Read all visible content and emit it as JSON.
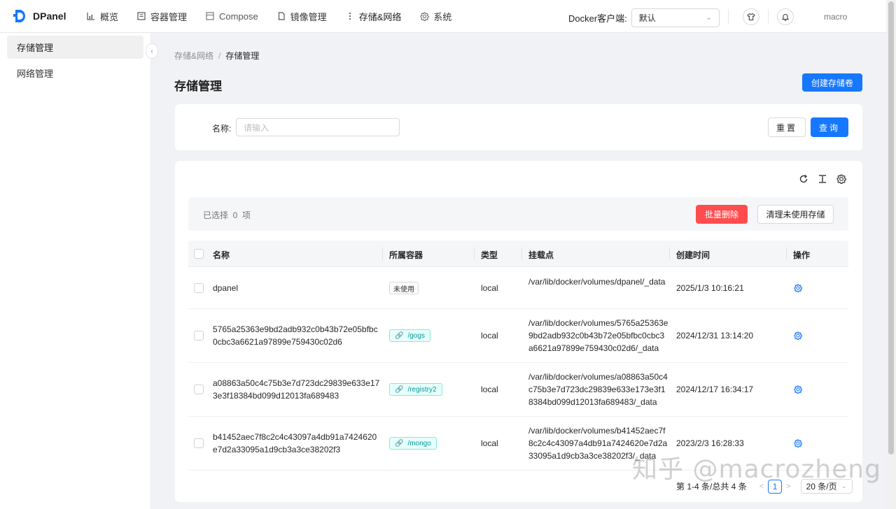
{
  "app": {
    "name": "DPanel"
  },
  "nav": [
    {
      "label": "概览",
      "icon": "chart-icon"
    },
    {
      "label": "容器管理",
      "icon": "container-icon"
    },
    {
      "label": "Compose",
      "icon": "compose-icon"
    },
    {
      "label": "镜像管理",
      "icon": "file-icon"
    },
    {
      "label": "存储&网络",
      "icon": "more-vertical-icon"
    },
    {
      "label": "系统",
      "icon": "gear-icon"
    }
  ],
  "header": {
    "docker_client_label": "Docker客户端:",
    "docker_client_value": "默认",
    "user": "macro"
  },
  "sidebar": {
    "items": [
      {
        "label": "存储管理"
      },
      {
        "label": "网络管理"
      }
    ]
  },
  "breadcrumb": {
    "parent": "存储&网络",
    "separator": "/",
    "current": "存储管理"
  },
  "page": {
    "title": "存储管理",
    "create_button": "创建存储卷"
  },
  "search": {
    "name_label": "名称:",
    "name_placeholder": "请输入",
    "reset_label": "重置",
    "query_label": "查询"
  },
  "selection": {
    "text": "已选择  0  项",
    "batch_delete": "批量删除",
    "prune_unused": "清理未使用存储"
  },
  "table": {
    "columns": {
      "name": "名称",
      "container": "所属容器",
      "type": "类型",
      "mount": "挂载点",
      "created": "创建时间",
      "action": "操作"
    },
    "rows": [
      {
        "name": "dpanel",
        "container": "未使用",
        "container_used": false,
        "type": "local",
        "mount": "/var/lib/docker/volumes/dpanel/_data",
        "created": "2025/1/3 10:16:21"
      },
      {
        "name": "5765a25363e9bd2adb932c0b43b72e05bfbc0cbc3a6621a97899e759430c02d6",
        "container": "/gogs",
        "container_used": true,
        "type": "local",
        "mount": "/var/lib/docker/volumes/5765a25363e9bd2adb932c0b43b72e05bfbc0cbc3a6621a97899e759430c02d6/_data",
        "created": "2024/12/31 13:14:20"
      },
      {
        "name": "a08863a50c4c75b3e7d723dc29839e633e173e3f18384bd099d12013fa689483",
        "container": "/registry2",
        "container_used": true,
        "type": "local",
        "mount": "/var/lib/docker/volumes/a08863a50c4c75b3e7d723dc29839e633e173e3f18384bd099d12013fa689483/_data",
        "created": "2024/12/17 16:34:17"
      },
      {
        "name": "b41452aec7f8c2c4c43097a4db91a7424620e7d2a33095a1d9cb3a3ce38202f3",
        "container": "/mongo",
        "container_used": true,
        "type": "local",
        "mount": "/var/lib/docker/volumes/b41452aec7f8c2c4c43097a4db91a7424620e7d2a33095a1d9cb3a3ce38202f3/_data",
        "created": "2023/2/3 16:28:33"
      }
    ]
  },
  "pagination": {
    "total_text": "第 1-4 条/总共 4 条",
    "current_page": "1",
    "page_size": "20 条/页"
  },
  "watermark": "知乎 @macrozheng",
  "colors": {
    "primary": "#1677ff",
    "danger": "#ff4d4f",
    "link_tag": "#08979c"
  }
}
